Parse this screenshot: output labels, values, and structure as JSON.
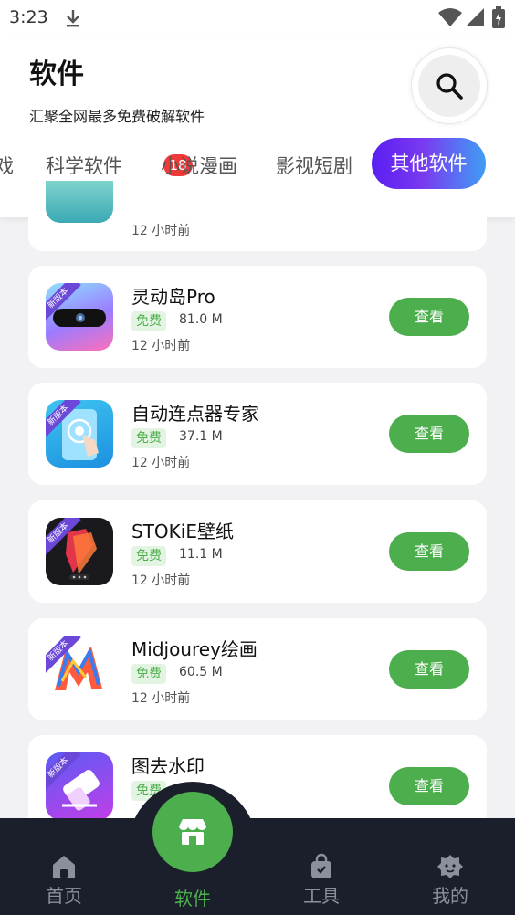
{
  "status_bar": {
    "time": "3:23"
  },
  "header": {
    "title": "软件",
    "subtitle": "汇聚全网最多免费破解软件"
  },
  "tabs": [
    {
      "label": "戏"
    },
    {
      "label": "科学软件",
      "badge": "18"
    },
    {
      "label": "小说漫画"
    },
    {
      "label": "影视短剧"
    },
    {
      "label": "其他软件",
      "active": true
    }
  ],
  "partial_card": {
    "time": "12 小时前"
  },
  "apps": [
    {
      "name": "灵动岛Pro",
      "free": "免费",
      "size": "81.0 M",
      "time": "12 小时前",
      "ribbon": "新版本",
      "button": "查看",
      "icon": "dynamic-island-icon"
    },
    {
      "name": "自动连点器专家",
      "free": "免费",
      "size": "37.1 M",
      "time": "12 小时前",
      "ribbon": "新版本",
      "button": "查看",
      "icon": "auto-clicker-icon"
    },
    {
      "name": "STOKiE壁纸",
      "free": "免费",
      "size": "11.1 M",
      "time": "12 小时前",
      "ribbon": "新版本",
      "button": "查看",
      "icon": "stokie-wallpaper-icon"
    },
    {
      "name": "Midjourey绘画",
      "free": "免费",
      "size": "60.5 M",
      "time": "12 小时前",
      "ribbon": "新版本",
      "button": "查看",
      "icon": "midjourney-icon"
    },
    {
      "name": "图去水印",
      "free": "免费",
      "size": "",
      "time": "",
      "ribbon": "新版本",
      "button": "查看",
      "icon": "eraser-icon"
    }
  ],
  "bottom_nav": {
    "home": "首页",
    "software": "软件",
    "tools": "工具",
    "mine": "我的"
  },
  "colors": {
    "accent_green": "#4cae4c",
    "badge_red": "#f03a3a",
    "tab_gradient_start": "#5a1ef2",
    "tab_gradient_end": "#3f9ef5",
    "nav_background": "#1b1f2b"
  }
}
